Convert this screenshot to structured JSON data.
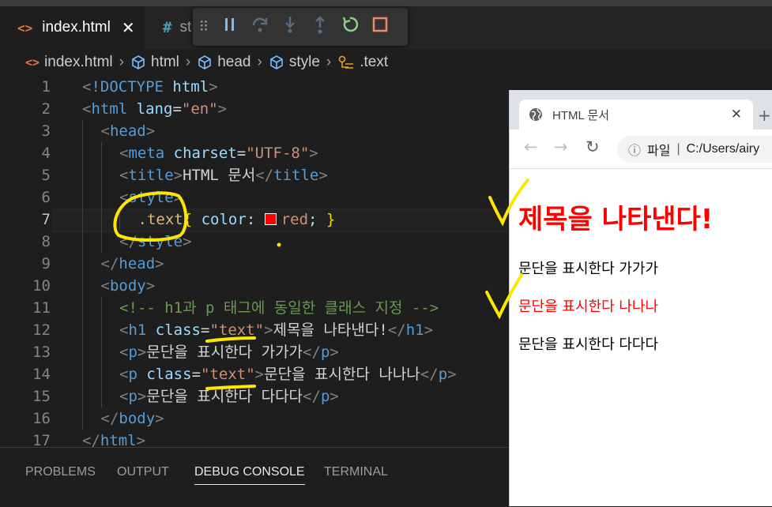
{
  "tabs": [
    {
      "label": "index.html",
      "icon": "<>",
      "close": "✕"
    },
    {
      "label": "st",
      "icon": "#"
    }
  ],
  "debug_toolbar": {
    "buttons": [
      "grip",
      "pause",
      "step-over",
      "step-into",
      "step-out",
      "restart",
      "stop"
    ],
    "colors": {
      "pause": "#75beff",
      "step": "#75beff",
      "restart": "#89d185",
      "stop": "#f48771"
    }
  },
  "breadcrumb": [
    {
      "label": "index.html",
      "icon": "<>"
    },
    {
      "label": "html",
      "icon": "cube-icon"
    },
    {
      "label": "head",
      "icon": "cube-icon"
    },
    {
      "label": "style",
      "icon": "cube-icon"
    },
    {
      "label": ".text",
      "icon": "selector-icon"
    }
  ],
  "editor": {
    "current_line": 7,
    "lines": [
      {
        "n": "1",
        "indent": 0,
        "tokens": [
          [
            "br",
            "<"
          ],
          [
            "tag",
            "!DOCTYPE"
          ],
          [
            "txt",
            " "
          ],
          [
            "attr",
            "html"
          ],
          [
            "br",
            ">"
          ]
        ]
      },
      {
        "n": "2",
        "indent": 0,
        "tokens": [
          [
            "br",
            "<"
          ],
          [
            "tag",
            "html"
          ],
          [
            "txt",
            " "
          ],
          [
            "attr",
            "lang"
          ],
          [
            "txt",
            "="
          ],
          [
            "str",
            "\"en\""
          ],
          [
            "br",
            ">"
          ]
        ]
      },
      {
        "n": "3",
        "indent": 1,
        "tokens": [
          [
            "br",
            "<"
          ],
          [
            "tag",
            "head"
          ],
          [
            "br",
            ">"
          ]
        ]
      },
      {
        "n": "4",
        "indent": 2,
        "tokens": [
          [
            "br",
            "<"
          ],
          [
            "tag",
            "meta"
          ],
          [
            "txt",
            " "
          ],
          [
            "attr",
            "charset"
          ],
          [
            "txt",
            "="
          ],
          [
            "str",
            "\"UTF-8\""
          ],
          [
            "br",
            ">"
          ]
        ]
      },
      {
        "n": "5",
        "indent": 2,
        "tokens": [
          [
            "br",
            "<"
          ],
          [
            "tag",
            "title"
          ],
          [
            "br",
            ">"
          ],
          [
            "txt",
            "HTML 문서"
          ],
          [
            "br",
            "</"
          ],
          [
            "tag",
            "title"
          ],
          [
            "br",
            ">"
          ]
        ]
      },
      {
        "n": "6",
        "indent": 2,
        "tokens": [
          [
            "br",
            "<"
          ],
          [
            "tag",
            "style"
          ],
          [
            "br",
            ">"
          ]
        ]
      },
      {
        "n": "7",
        "indent": 3,
        "tokens": [
          [
            "sel",
            ".text"
          ],
          [
            "brace",
            "{"
          ],
          [
            "txt",
            " "
          ],
          [
            "attr",
            "color"
          ],
          [
            "txt",
            ": "
          ],
          [
            "swatch",
            ""
          ],
          [
            "val",
            "red"
          ],
          [
            "txt",
            "; "
          ],
          [
            "brace",
            "}"
          ]
        ]
      },
      {
        "n": "8",
        "indent": 2,
        "tokens": [
          [
            "br",
            "</"
          ],
          [
            "tag",
            "style"
          ],
          [
            "br",
            ">"
          ]
        ]
      },
      {
        "n": "9",
        "indent": 1,
        "tokens": [
          [
            "br",
            "</"
          ],
          [
            "tag",
            "head"
          ],
          [
            "br",
            ">"
          ]
        ]
      },
      {
        "n": "10",
        "indent": 1,
        "tokens": [
          [
            "br",
            "<"
          ],
          [
            "tag",
            "body"
          ],
          [
            "br",
            ">"
          ]
        ]
      },
      {
        "n": "11",
        "indent": 2,
        "tokens": [
          [
            "cmt",
            "<!-- h1과 p 태그에 동일한 클래스 지정 -->"
          ]
        ]
      },
      {
        "n": "12",
        "indent": 2,
        "tokens": [
          [
            "br",
            "<"
          ],
          [
            "tag",
            "h1"
          ],
          [
            "txt",
            " "
          ],
          [
            "attr",
            "class"
          ],
          [
            "txt",
            "="
          ],
          [
            "str",
            "\"text\""
          ],
          [
            "br",
            ">"
          ],
          [
            "txt",
            "제목을 나타낸다!"
          ],
          [
            "br",
            "</"
          ],
          [
            "tag",
            "h1"
          ],
          [
            "br",
            ">"
          ]
        ]
      },
      {
        "n": "13",
        "indent": 2,
        "tokens": [
          [
            "br",
            "<"
          ],
          [
            "tag",
            "p"
          ],
          [
            "br",
            ">"
          ],
          [
            "txt",
            "문단을 표시한다 가가가"
          ],
          [
            "br",
            "</"
          ],
          [
            "tag",
            "p"
          ],
          [
            "br",
            ">"
          ]
        ]
      },
      {
        "n": "14",
        "indent": 2,
        "tokens": [
          [
            "br",
            "<"
          ],
          [
            "tag",
            "p"
          ],
          [
            "txt",
            " "
          ],
          [
            "attr",
            "class"
          ],
          [
            "txt",
            "="
          ],
          [
            "str",
            "\"text\""
          ],
          [
            "br",
            ">"
          ],
          [
            "txt",
            "문단을 표시한다 나나나"
          ],
          [
            "br",
            "</"
          ],
          [
            "tag",
            "p"
          ],
          [
            "br",
            ">"
          ]
        ]
      },
      {
        "n": "15",
        "indent": 2,
        "tokens": [
          [
            "br",
            "<"
          ],
          [
            "tag",
            "p"
          ],
          [
            "br",
            ">"
          ],
          [
            "txt",
            "문단을 표시한다 다다다"
          ],
          [
            "br",
            "</"
          ],
          [
            "tag",
            "p"
          ],
          [
            "br",
            ">"
          ]
        ]
      },
      {
        "n": "16",
        "indent": 1,
        "tokens": [
          [
            "br",
            "</"
          ],
          [
            "tag",
            "body"
          ],
          [
            "br",
            ">"
          ]
        ]
      },
      {
        "n": "17",
        "indent": 0,
        "tokens": [
          [
            "br",
            "</"
          ],
          [
            "tag",
            "html"
          ],
          [
            "br",
            ">"
          ]
        ]
      }
    ]
  },
  "panel": {
    "tabs": [
      "PROBLEMS",
      "OUTPUT",
      "DEBUG CONSOLE",
      "TERMINAL"
    ],
    "active": "DEBUG CONSOLE"
  },
  "browser": {
    "tab_title": "HTML 문서",
    "close": "✕",
    "address_label": "파일",
    "address": "C:/Users/airy",
    "page": {
      "h1": "제목을 나타낸다!",
      "p1": "문단을 표시한다 가가가",
      "p2": "문단을 표시한다 나나나",
      "p3": "문단을 표시한다 다다다",
      "h1_color": "#ff0000",
      "p2_color": "#ff0000",
      "p_color": "#000000"
    }
  },
  "annotation_color": "#ffe600"
}
